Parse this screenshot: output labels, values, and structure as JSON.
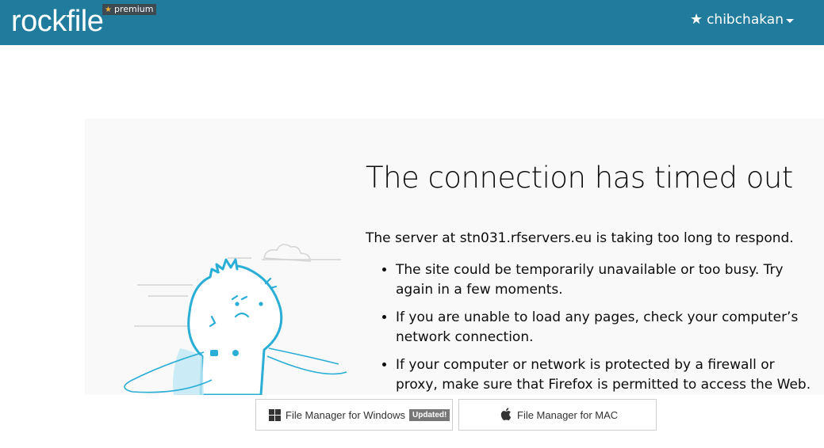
{
  "header": {
    "logo_text": "rockfile",
    "premium_badge": "premium",
    "username": "chibchakan",
    "bg_color": "#207b9d"
  },
  "error_page": {
    "title": "The connection has timed out",
    "message": "The server at stn031.rfservers.eu is taking too long to respond.",
    "bullets": [
      "The site could be temporarily unavailable or too busy. Try again in a few moments.",
      "If you are unable to load any pages, check your computer’s network connection.",
      "If your computer or network is protected by a firewall or proxy, make sure that Firefox is permitted to access the Web."
    ]
  },
  "downloads": {
    "windows_label": "File Manager for Windows",
    "windows_badge": "Updated!",
    "mac_label": "File Manager for MAC"
  },
  "icons": [
    "star-icon",
    "windows-icon",
    "apple-icon",
    "caret-down-icon"
  ]
}
